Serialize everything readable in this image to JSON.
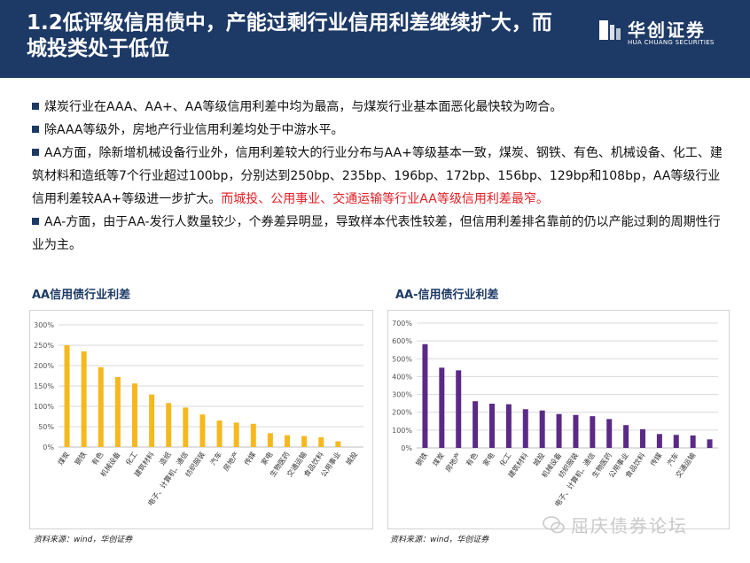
{
  "header": {
    "title": "1.2低评级信用债中，产能过剩行业信用利差继续扩大，而城投类处于低位",
    "logo_cn": "华创证券",
    "logo_en": "HUA CHUANG SECURITIES"
  },
  "bullets": [
    {
      "text": "煤炭行业在AAA、AA+、AA等级信用利差中均为最高，与煤炭行业基本面恶化最快较为吻合。",
      "highlight": ""
    },
    {
      "text": "除AAA等级外，房地产行业信用利差均处于中游水平。",
      "highlight": ""
    },
    {
      "text": "AA方面，除新增机械设备行业外，信用利差较大的行业分布与AA+等级基本一致，煤炭、钢铁、有色、机械设备、化工、建筑材料和造纸等7个行业超过100bp，分别达到250bp、235bp、196bp、172bp、156bp、129bp和108bp，AA等级行业信用利差较AA+等级进一步扩大。",
      "highlight": "而城投、公用事业、交通运输等行业AA等级信用利差最窄。"
    },
    {
      "text": "AA-方面，由于AA-发行人数量较少，个券差异明显，导致样本代表性较差，但信用利差排名靠前的仍以产能过剩的周期性行业为主。",
      "highlight": ""
    }
  ],
  "charts": {
    "left_source": "资料来源：wind，华创证券",
    "right_source": "资料来源：wind，华创证券"
  },
  "watermark": "屈庆债券论坛",
  "chart_data": [
    {
      "type": "bar",
      "title": "AA信用债行业利差",
      "color": "#f5b91f",
      "categories": [
        "煤炭",
        "钢铁",
        "有色",
        "机械设备",
        "化工",
        "建筑材料",
        "造纸",
        "电子、计算机、通信",
        "纺织服装",
        "汽车",
        "房地产",
        "传媒",
        "家电",
        "生物医药",
        "交通运输",
        "食品饮料",
        "公用事业",
        "城投"
      ],
      "values": [
        2.5,
        2.35,
        1.96,
        1.72,
        1.56,
        1.29,
        1.08,
        0.97,
        0.8,
        0.65,
        0.6,
        0.57,
        0.34,
        0.29,
        0.27,
        0.24,
        0.14,
        0.0
      ],
      "ylim": [
        0,
        3
      ],
      "yticks": [
        "0%",
        "50%",
        "100%",
        "150%",
        "200%",
        "250%",
        "300%"
      ],
      "grid": true
    },
    {
      "type": "bar",
      "title": "AA-信用债行业利差",
      "color": "#5b2a86",
      "categories": [
        "钢铁",
        "煤炭",
        "房地产",
        "有色",
        "家电",
        "化工",
        "建筑材料",
        "城投",
        "机械设备",
        "纺织服装",
        "电子、计算机、通信",
        "生物医药",
        "公用事业",
        "食品饮料",
        "传媒",
        "汽车",
        "交通运输"
      ],
      "values": [
        5.82,
        4.5,
        4.35,
        2.62,
        2.48,
        2.45,
        2.17,
        2.1,
        1.9,
        1.85,
        1.78,
        1.62,
        1.28,
        1.05,
        0.78,
        0.73,
        0.7,
        0.48
      ],
      "ylim": [
        0,
        7
      ],
      "yticks": [
        "0%",
        "100%",
        "200%",
        "300%",
        "400%",
        "500%",
        "600%",
        "700%"
      ],
      "grid": true
    }
  ]
}
